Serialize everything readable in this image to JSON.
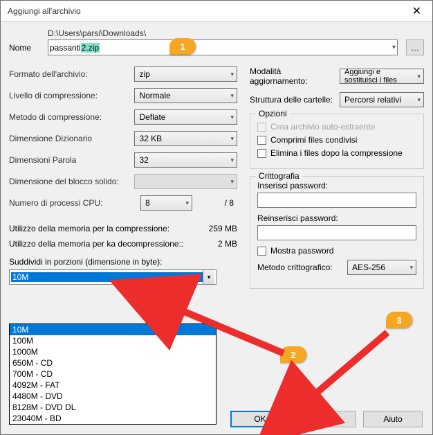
{
  "window": {
    "title": "Aggiungi all'archivio"
  },
  "name": {
    "label": "Nome",
    "path": "D:\\Users\\parsi\\Downloads\\",
    "value_pre": "passanti ",
    "value_hl": "2.zip",
    "browse": "…"
  },
  "left": {
    "format_label": "Formato dell'archivio:",
    "format_value": "zip",
    "level_label": "Livello di compressione:",
    "level_value": "Normale",
    "method_label": "Metodo di compressione:",
    "method_value": "Deflate",
    "dict_label": "Dimensione Dizionario",
    "dict_value": "32 KB",
    "word_label": "Dimensioni Parola",
    "word_value": "32",
    "solid_label": "Dimensione del blocco solido:",
    "solid_value": "",
    "cpu_label": "Numero di processi CPU:",
    "cpu_value": "8",
    "cpu_total": "/ 8",
    "mem_comp_label": "Utilizzo della memoria per la compressione:",
    "mem_comp_value": "259 MB",
    "mem_decomp_label": "Utilizzo della memoria per ka decompressione::",
    "mem_decomp_value": "2 MB",
    "split_label": "Suddividi in porzioni (dimensione in byte):",
    "split_value": "10M",
    "split_options": [
      "10M",
      "100M",
      "1000M",
      "650M - CD",
      "700M - CD",
      "4092M - FAT",
      "4480M - DVD",
      "8128M - DVD DL",
      "23040M - BD"
    ]
  },
  "right": {
    "update_label": "Modalità aggiornamento:",
    "update_value": "Aggiungi e sostituisci i files",
    "paths_label": "Struttura delle cartelle:",
    "paths_value": "Percorsi relativi",
    "options_legend": "Opzioni",
    "opt_sfx": "Crea archivio auto-estraente",
    "opt_shared": "Comprimi files condivisi",
    "opt_delete": "Elimina i files dopo la compressione",
    "crypto_legend": "Crittografia",
    "pwd_label": "Inserisci password:",
    "repwd_label": "Reinserisci password:",
    "show_pwd": "Mostra password",
    "enc_method_label": "Metodo crittografico:",
    "enc_method_value": "AES-256"
  },
  "buttons": {
    "ok": "OK",
    "cancel": "Annulla",
    "help": "Aiuto"
  },
  "badges": {
    "b1": "1",
    "b2": "2",
    "b3": "3"
  }
}
